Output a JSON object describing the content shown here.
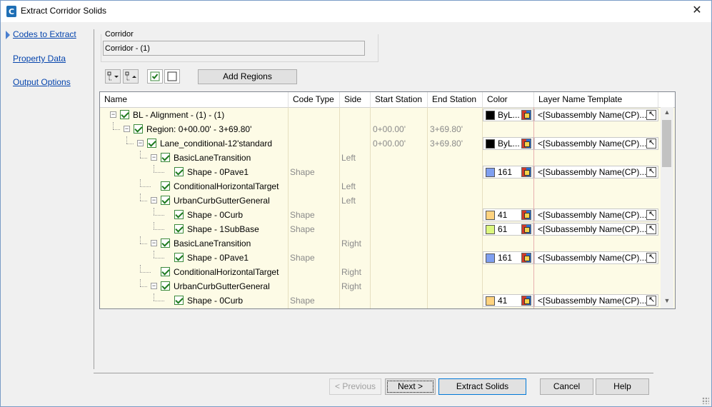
{
  "window": {
    "title": "Extract Corridor Solids"
  },
  "nav": {
    "items": [
      "Codes to Extract",
      "Property Data",
      "Output Options"
    ]
  },
  "corridor": {
    "label": "Corridor",
    "value": "Corridor - (1)"
  },
  "toolbar": {
    "add_regions_label": "Add Regions"
  },
  "grid": {
    "columns": [
      "Name",
      "Code Type",
      "Side",
      "Start Station",
      "End Station",
      "Color",
      "Layer Name Template"
    ],
    "rows": [
      {
        "name": "BL - Alignment - (1) - (1)",
        "level": 0,
        "toggle": "−",
        "code_type": "",
        "side": "",
        "start": "",
        "end": "",
        "color_label": "ByL...",
        "swatch": "#000000",
        "layer": "<[Subassembly Name(CP)..."
      },
      {
        "name": "Region: 0+00.00' - 3+69.80'",
        "level": 1,
        "toggle": "−",
        "code_type": "",
        "side": "",
        "start": "0+00.00'",
        "end": "3+69.80'",
        "color_label": "",
        "swatch": "",
        "layer": ""
      },
      {
        "name": "Lane_conditional-12'standard",
        "level": 2,
        "toggle": "−",
        "code_type": "",
        "side": "",
        "start": "0+00.00'",
        "end": "3+69.80'",
        "color_label": "ByL...",
        "swatch": "#000000",
        "layer": "<[Subassembly Name(CP)..."
      },
      {
        "name": "BasicLaneTransition",
        "level": 3,
        "toggle": "−",
        "code_type": "",
        "side": "Left",
        "start": "",
        "end": "",
        "color_label": "",
        "swatch": "",
        "layer": ""
      },
      {
        "name": "Shape - 0Pave1",
        "level": 4,
        "toggle": "",
        "code_type": "Shape",
        "side": "",
        "start": "",
        "end": "",
        "color_label": "161",
        "swatch": "#7f9ff0",
        "layer": "<[Subassembly Name(CP)..."
      },
      {
        "name": "ConditionalHorizontalTarget",
        "level": 3,
        "toggle": "",
        "code_type": "",
        "side": "Left",
        "start": "",
        "end": "",
        "color_label": "",
        "swatch": "",
        "layer": ""
      },
      {
        "name": "UrbanCurbGutterGeneral",
        "level": 3,
        "toggle": "−",
        "code_type": "",
        "side": "Left",
        "start": "",
        "end": "",
        "color_label": "",
        "swatch": "",
        "layer": ""
      },
      {
        "name": "Shape - 0Curb",
        "level": 4,
        "toggle": "",
        "code_type": "Shape",
        "side": "",
        "start": "",
        "end": "",
        "color_label": "41",
        "swatch": "#ffd37f",
        "layer": "<[Subassembly Name(CP)..."
      },
      {
        "name": "Shape - 1SubBase",
        "level": 4,
        "toggle": "",
        "code_type": "Shape",
        "side": "",
        "start": "",
        "end": "",
        "color_label": "61",
        "swatch": "#dcf77f",
        "layer": "<[Subassembly Name(CP)..."
      },
      {
        "name": "BasicLaneTransition",
        "level": 3,
        "toggle": "−",
        "code_type": "",
        "side": "Right",
        "start": "",
        "end": "",
        "color_label": "",
        "swatch": "",
        "layer": ""
      },
      {
        "name": "Shape - 0Pave1",
        "level": 4,
        "toggle": "",
        "code_type": "Shape",
        "side": "",
        "start": "",
        "end": "",
        "color_label": "161",
        "swatch": "#7f9ff0",
        "layer": "<[Subassembly Name(CP)..."
      },
      {
        "name": "ConditionalHorizontalTarget",
        "level": 3,
        "toggle": "",
        "code_type": "",
        "side": "Right",
        "start": "",
        "end": "",
        "color_label": "",
        "swatch": "",
        "layer": ""
      },
      {
        "name": "UrbanCurbGutterGeneral",
        "level": 3,
        "toggle": "−",
        "code_type": "",
        "side": "Right",
        "start": "",
        "end": "",
        "color_label": "",
        "swatch": "",
        "layer": ""
      },
      {
        "name": "Shape - 0Curb",
        "level": 4,
        "toggle": "",
        "code_type": "Shape",
        "side": "",
        "start": "",
        "end": "",
        "color_label": "41",
        "swatch": "#ffd37f",
        "layer": "<[Subassembly Name(CP)..."
      }
    ]
  },
  "footer": {
    "previous_label": "< Previous",
    "next_label": "Next >",
    "extract_label": "Extract Solids",
    "cancel_label": "Cancel",
    "help_label": "Help"
  },
  "colors": {
    "accent": "#0078d7",
    "link": "#0645ad",
    "grid_bg": "#fdfbe6",
    "check_green": "#1e7a1e"
  }
}
